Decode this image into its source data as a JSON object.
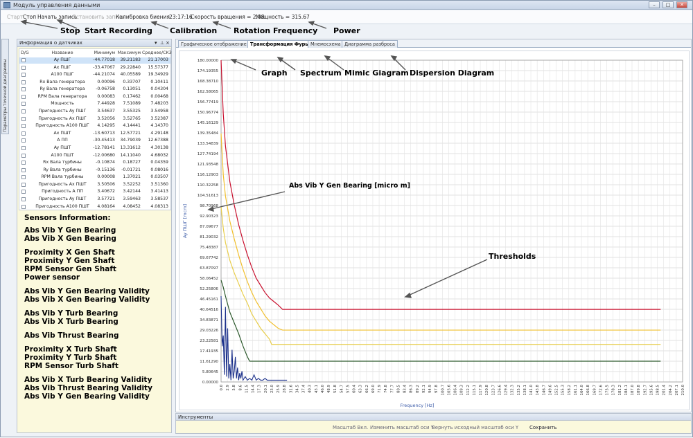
{
  "window": {
    "title": "Модуль управления данными",
    "buttons": [
      "–",
      "□",
      "✕"
    ]
  },
  "toolbar": {
    "start": "Старт",
    "stop": "Стоп",
    "record": "Начать запись",
    "stop_record": "Остановить запись",
    "calibration": "Калибровка биения",
    "time": "23:17:16",
    "rotation": "Скорость вращения = 2.08",
    "power": "Мощность = 315.67"
  },
  "annotations": {
    "stop": "Stop",
    "start_recording": "Start Recording",
    "calibration": "Calibration",
    "rotation": "Rotation Frequency",
    "power": "Power",
    "graph": "Graph",
    "spectrum": "Spectrum",
    "mimic": "Mimic Giagram",
    "dispersion": "Dispersion Diagram",
    "signal": "Abs Vib Y Gen Bearing [micro m]",
    "thresholds": "Thresholds"
  },
  "side_tab": "Параметры точечной диаграммы",
  "sensors_panel": {
    "title": "Информация о датчиках",
    "headers": [
      "D/G",
      "Название",
      "Минимум",
      "Максимум",
      "Среднее/СКЗ"
    ],
    "rows": [
      [
        "Ay ПШГ",
        "-44.77018",
        "39.21183",
        "21.17003"
      ],
      [
        "Ax ПШГ",
        "-33.47067",
        "29.22840",
        "15.57377"
      ],
      [
        "A100 ПШГ",
        "-44.21074",
        "40.05589",
        "19.34929"
      ],
      [
        "Rx Вала генератора",
        "0.00096",
        "0.33707",
        "0.10411"
      ],
      [
        "Ry Вала генератора",
        "-0.06758",
        "0.13051",
        "0.04304"
      ],
      [
        "RPM Вала генератора",
        "0.00083",
        "0.17462",
        "0.00468"
      ],
      [
        "Мощность",
        "7.44928",
        "7.51089",
        "7.48203"
      ],
      [
        "Пригодность Ay ПШГ",
        "3.54637",
        "3.55325",
        "3.54958"
      ],
      [
        "Пригодность Ax ПШГ",
        "3.52056",
        "3.52765",
        "3.52387"
      ],
      [
        "Пригодность A100 ПШГ",
        "4.14295",
        "4.14441",
        "4.14370"
      ],
      [
        "Ax ПШТ",
        "-13.60713",
        "12.57721",
        "4.29148"
      ],
      [
        "A ПП",
        "-30.45413",
        "34.79039",
        "12.67388"
      ],
      [
        "Ay ПШТ",
        "-12.78141",
        "13.31612",
        "4.30138"
      ],
      [
        "A100 ПШТ",
        "-12.00680",
        "14.11040",
        "4.68032"
      ],
      [
        "Rx Вала турбины",
        "-0.10874",
        "0.18727",
        "0.04359"
      ],
      [
        "Ry Вала турбины",
        "-0.15136",
        "-0.01721",
        "0.08016"
      ],
      [
        "RPM Вала турбины",
        "0.00008",
        "1.37021",
        "0.03507"
      ],
      [
        "Пригодность Ax ПШТ",
        "3.50506",
        "3.52252",
        "3.51360"
      ],
      [
        "Пригодность A ПП",
        "3.40672",
        "3.42144",
        "3.41413"
      ],
      [
        "Пригодность Ay ПШТ",
        "3.57721",
        "3.59463",
        "3.58537"
      ],
      [
        "Пригодность A100 ПШТ",
        "4.08164",
        "4.08452",
        "4.08313"
      ]
    ]
  },
  "legend": {
    "title": "Sensors Information:",
    "items": [
      "Abs Vib Y Gen Bearing",
      "Abs Vib X Gen Bearing",
      "Proximity X Gen Shaft",
      "Proximity Y Gen Shaft",
      "RPM Sensor Gen Shaft",
      "Power sensor",
      "Abs Vib Y Gen Bearing Validity",
      "Abs Vib X Gen Bearing Validity",
      "Abs Vib Y Turb Bearing",
      "Abs Vib X Turb Bearing",
      "Abs Vib Thrust Bearing",
      "Proximity X Turb Shaft",
      "Proximity Y Turb Shaft",
      "RPM Sensor Turb Shaft",
      "Abs Vib X Turb Bearing Validity",
      "Abs Vib Thrust Bearing Validity",
      "Abs Vib Y Gen Bearing Validity"
    ]
  },
  "tabs": [
    "Графическое отображение",
    "Трансформация Фурье",
    "Мнемосхема",
    "Диаграмма разброса"
  ],
  "active_tab": 1,
  "tools": {
    "title": "Инструменты",
    "buttons": [
      "Масштаб Вкл.",
      "Изменить масштаб оси Y",
      "Вернуть исходный масштаб оси Y",
      "Сохранить"
    ]
  },
  "colors": {
    "red": "#c8102e",
    "orange": "#f1bf2c",
    "yellow": "#e8cd4a",
    "green": "#2e5a2e",
    "signal": "#1a2f8a"
  },
  "chart_data": {
    "type": "line",
    "xlabel": "Frequency [Hz]",
    "ylabel": "Ay ПШГ [mcm]",
    "ylim": [
      0,
      180
    ],
    "xlim": [
      0,
      210
    ],
    "yticks": [
      "180.00000",
      "174.19355",
      "168.38710",
      "162.58065",
      "156.77419",
      "150.96774",
      "145.16129",
      "139.35484",
      "133.54839",
      "127.74194",
      "121.93548",
      "116.12903",
      "110.32258",
      "104.51613",
      "98.70968",
      "92.90323",
      "87.09677",
      "81.29032",
      "75.48387",
      "69.67742",
      "63.87097",
      "58.06452",
      "52.25806",
      "46.45161",
      "40.64516",
      "34.83871",
      "29.03226",
      "23.22581",
      "17.41935",
      "11.61290",
      "5.80645",
      "0.00000"
    ],
    "xticks": [
      "0.0",
      "2.9",
      "5.8",
      "8.6",
      "11.5",
      "14.4",
      "17.3",
      "20.1",
      "23.0",
      "25.9",
      "28.8",
      "31.6",
      "34.5",
      "37.4",
      "40.3",
      "43.1",
      "46.0",
      "48.9",
      "51.8",
      "54.7",
      "57.5",
      "60.4",
      "63.3",
      "66.2",
      "69.0",
      "71.9",
      "74.8",
      "77.7",
      "80.5",
      "83.4",
      "86.3",
      "89.2",
      "92.1",
      "94.9",
      "97.8",
      "100.7",
      "103.6",
      "106.4",
      "109.3",
      "112.2",
      "115.1",
      "117.9",
      "120.8",
      "123.7",
      "126.6",
      "129.4",
      "132.3",
      "135.2",
      "138.1",
      "141.0",
      "143.8",
      "146.7",
      "149.6",
      "152.5",
      "155.3",
      "158.2",
      "161.1",
      "164.0",
      "166.8",
      "169.7",
      "172.6",
      "175.5",
      "178.3",
      "181.2",
      "184.1",
      "187.0",
      "189.8",
      "192.7",
      "195.6",
      "198.5",
      "201.4",
      "204.2",
      "207.1",
      "210.0"
    ],
    "series": [
      {
        "color": "red",
        "x": [
          0,
          1,
          2,
          4,
          6,
          8,
          10,
          12,
          14,
          16,
          18,
          20,
          22,
          24,
          26,
          28,
          200
        ],
        "y": [
          180,
          150,
          132,
          112,
          99,
          88,
          79,
          71,
          64,
          58,
          54,
          50,
          47,
          45,
          43,
          40.6,
          40.6
        ]
      },
      {
        "color": "orange",
        "x": [
          0,
          1,
          2,
          4,
          6,
          8,
          10,
          12,
          14,
          16,
          18,
          20,
          22,
          24,
          26,
          28,
          200
        ],
        "y": [
          139,
          116,
          104,
          90,
          80,
          71,
          63,
          56,
          50,
          45,
          41,
          37,
          34,
          32,
          30,
          29,
          29
        ]
      },
      {
        "color": "yellow",
        "x": [
          0,
          1,
          2,
          4,
          6,
          8,
          10,
          12,
          14,
          16,
          18,
          20,
          22,
          23,
          200
        ],
        "y": [
          98,
          86,
          78,
          68,
          61,
          55,
          49,
          44,
          38,
          34,
          30,
          27,
          24,
          21,
          21
        ]
      },
      {
        "color": "green",
        "x": [
          0,
          1,
          2,
          4,
          6,
          8,
          10,
          12,
          13,
          200
        ],
        "y": [
          57,
          53,
          48,
          39,
          33,
          27,
          20,
          14,
          11.6,
          11.6
        ]
      },
      {
        "color": "signal",
        "x": [
          0,
          0.5,
          1,
          1.5,
          2,
          2.5,
          3,
          3.5,
          4,
          4.5,
          5,
          5.5,
          6,
          6.5,
          7,
          7.5,
          8,
          8.5,
          9,
          9.5,
          10,
          11,
          12,
          13,
          14,
          15,
          16,
          17,
          18,
          19,
          20,
          21,
          22,
          23,
          24,
          25,
          26,
          27,
          28,
          29,
          30
        ],
        "y": [
          48,
          20,
          26,
          4,
          42,
          3,
          30,
          2,
          10,
          1,
          18,
          2,
          6,
          14,
          2,
          8,
          1,
          5,
          2,
          6,
          1,
          3,
          1,
          2,
          1,
          4,
          1,
          2,
          1,
          1,
          2,
          1,
          1,
          1,
          1,
          1,
          1,
          1,
          1,
          1,
          1
        ]
      }
    ]
  }
}
